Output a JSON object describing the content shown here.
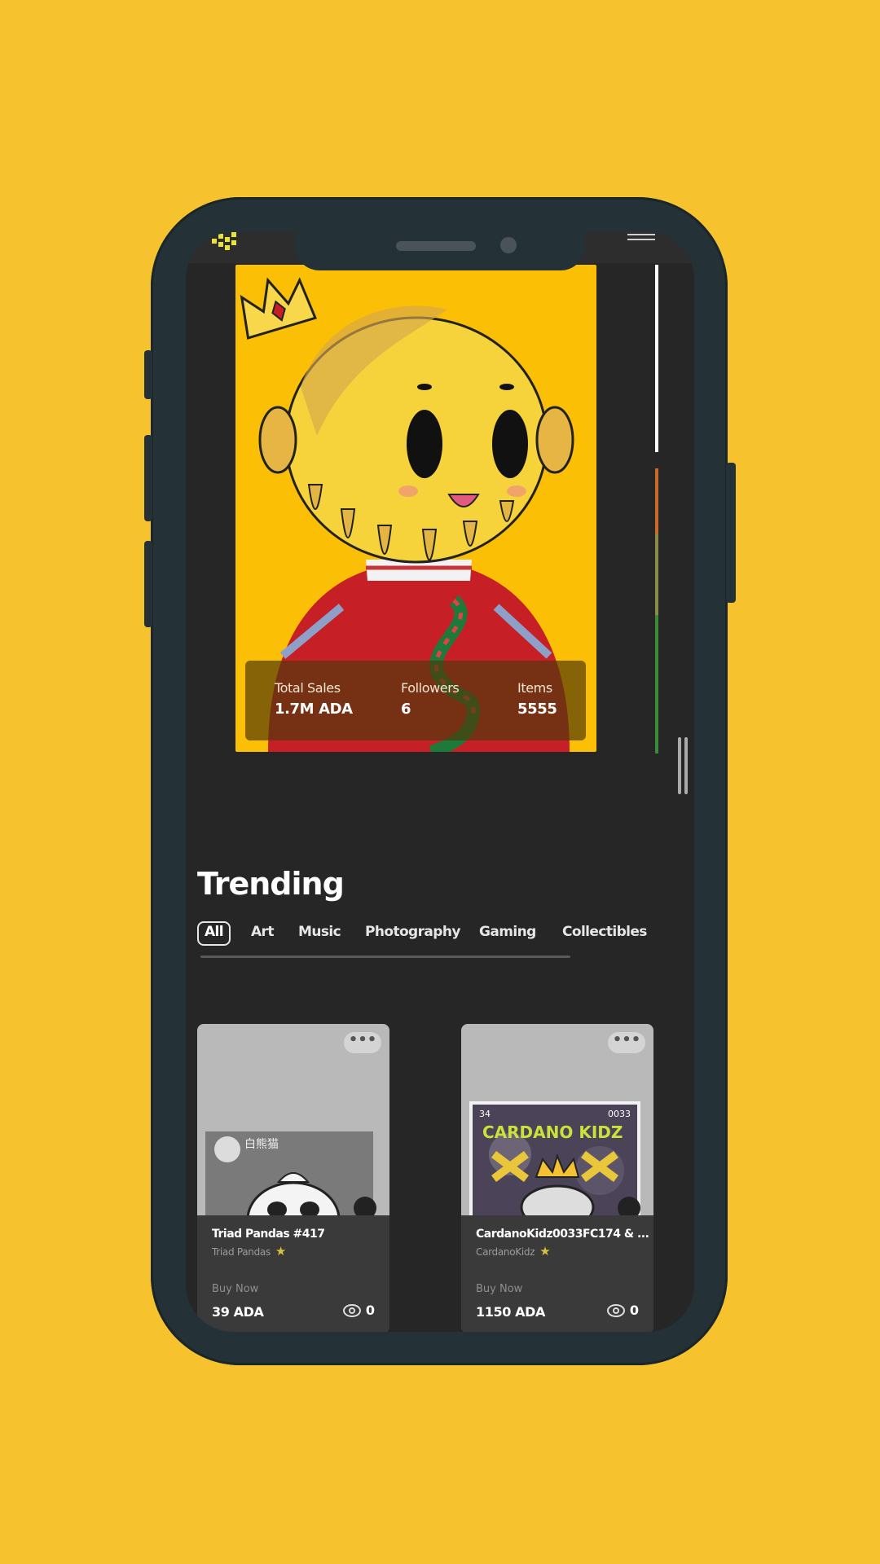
{
  "hero": {
    "stats": [
      {
        "label": "Total Sales",
        "value": "1.7M ADA"
      },
      {
        "label": "Followers",
        "value": "6"
      },
      {
        "label": "Items",
        "value": "5555"
      }
    ]
  },
  "trending": {
    "title": "Trending",
    "tabs": [
      "All",
      "Art",
      "Music",
      "Photography",
      "Gaming",
      "Collectibles"
    ],
    "active_tab": "All"
  },
  "cards": [
    {
      "name": "Triad Pandas #417",
      "collection": "Triad Pandas",
      "status": "Buy Now",
      "price": "39 ADA",
      "views": "0",
      "more": "•••"
    },
    {
      "name": "CardanoKidz0033FC174 & ...",
      "collection": "CardanoKidz",
      "status": "Buy Now",
      "price": "1150 ADA",
      "views": "0",
      "more": "•••"
    }
  ],
  "artwork_text": {
    "kidz_banner": "CARDANO KIDZ",
    "kidz_left_num": "34",
    "kidz_right_num": "0033",
    "panda_header": "白熊猫"
  },
  "colors": {
    "page_bg": "#F6C32E",
    "phone_frame": "#243237",
    "app_bg": "#262627",
    "hero_bg": "#FBBF06",
    "card_bg": "#3a3a3b"
  },
  "icons": [
    "logo-icon",
    "menu-icon",
    "more-icon",
    "eye-icon",
    "verified-star-icon"
  ]
}
